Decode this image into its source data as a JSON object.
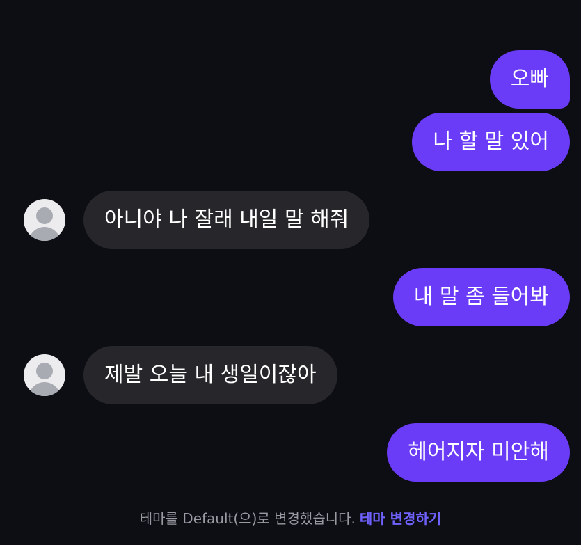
{
  "messages": [
    {
      "side": "sent",
      "text": "오빠"
    },
    {
      "side": "sent",
      "text": "나 할 말 있어"
    },
    {
      "side": "received",
      "text": "아니야 나 잘래 내일 말 해줘"
    },
    {
      "side": "sent",
      "text": "내 말 좀 들어봐"
    },
    {
      "side": "received",
      "text": "제발 오늘 내 생일이잖아"
    },
    {
      "side": "sent",
      "text": "헤어지자 미안해"
    }
  ],
  "footer": {
    "notice": "테마를 Default(으)로 변경했습니다.",
    "change_theme_link": "테마 변경하기"
  },
  "colors": {
    "background": "#0d0d14",
    "sent_bubble": "#6b3cf7",
    "received_bubble": "#26262b",
    "link": "#6f62ff"
  }
}
